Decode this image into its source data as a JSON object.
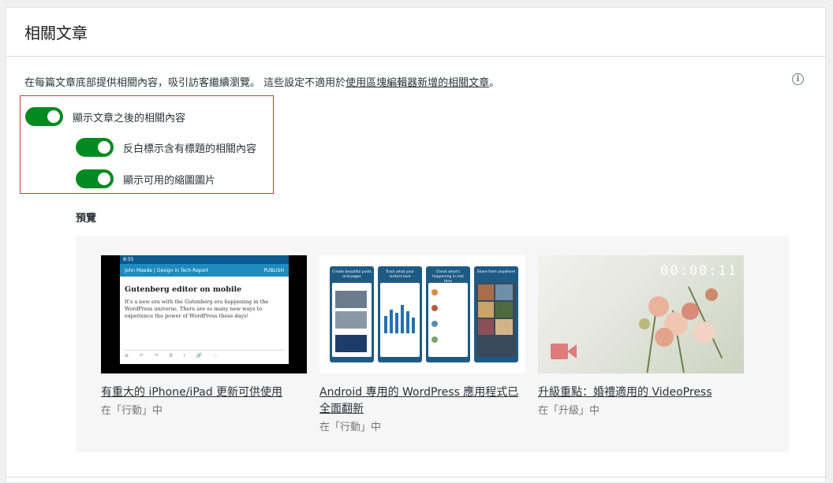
{
  "header": {
    "title": "相關文章"
  },
  "description": {
    "text": "在每篇文章底部提供相關內容，吸引訪客繼續瀏覽。 這些設定不適用於",
    "link": "使用區塊編輯器新增的相關文章",
    "suffix": "。"
  },
  "info_icon": "info-icon",
  "toggles": [
    {
      "label": "顯示文章之後的相關內容",
      "checked": true
    },
    {
      "label": "反白標示含有標題的相關內容",
      "checked": true
    },
    {
      "label": "顯示可用的縮圖圖片",
      "checked": true
    }
  ],
  "preview": {
    "label": "預覽",
    "items": [
      {
        "title": "有重大的 iPhone/iPad 更新可供使用",
        "meta": "在「行動」中"
      },
      {
        "title": "Android 專用的 WordPress 應用程式已全面翻新",
        "meta": "在「行動」中"
      },
      {
        "title": "升級重點：婚禮適用的 VideoPress",
        "meta": "在「升級」中"
      }
    ]
  },
  "thumb1": {
    "status": "8:55",
    "appbar_title": "John Maeda | Design in Tech Report",
    "appbar_action": "PUBLISH",
    "heading": "Gutenberg editor on mobile",
    "body": "It's a new era with the Gutenberg era happening in the WordPress universe. There are so many new ways to experience the power of WordPress these days!",
    "tools": "⊕ ↶ ↷ B I 🔗 ⋯"
  },
  "thumb2": {
    "captions": [
      "Create beautiful posts and pages",
      "Track what your visitors love",
      "Check what's happening in real time",
      "Share from anywhere"
    ]
  },
  "thumb3": {
    "timer": "00:00:11"
  },
  "colors": {
    "toggle_on": "#008a20",
    "highlight": "#d63638"
  }
}
